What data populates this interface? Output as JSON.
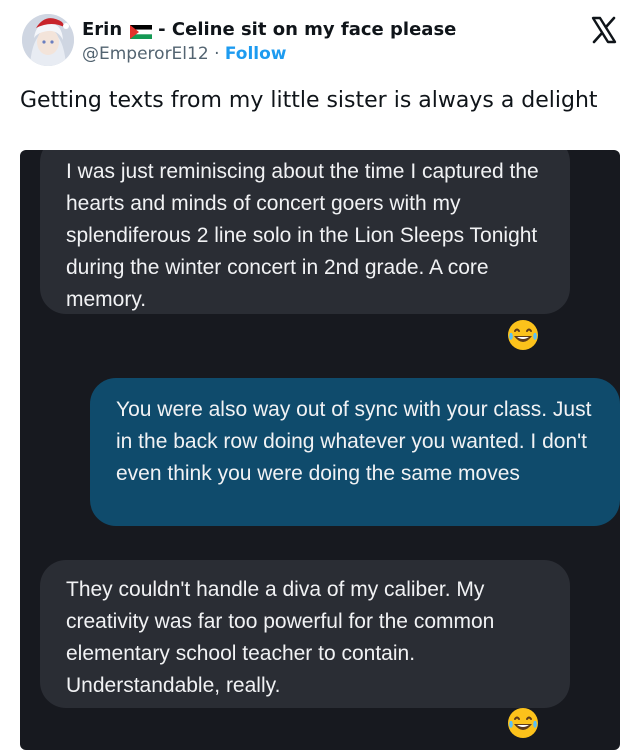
{
  "author": {
    "name": "Erin",
    "name_suffix": "- Celine sit on my face please",
    "handle": "@EmperorEl12",
    "separator": "·",
    "follow_label": "Follow"
  },
  "icons": {
    "flag": "palestine-flag-icon",
    "logo": "x-logo-icon",
    "reaction": "laughing-tears-emoji"
  },
  "tweet": {
    "text": "Getting texts from my little sister is always a delight"
  },
  "messages": [
    {
      "side": "incoming",
      "text": "I was just reminiscing about the time I captured the hearts and minds of concert goers with my splendiferous 2 line solo in the Lion Sleeps Tonight during the winter concert in 2nd grade. A core memory."
    },
    {
      "side": "outgoing",
      "text": "You were also way out of sync with your class. Just in the back row doing whatever you wanted. I don't even think you were doing the same moves"
    },
    {
      "side": "incoming",
      "text": "They couldn't handle a diva of my caliber. My creativity was far too powerful for the common elementary school teacher to contain. Understandable, really."
    }
  ],
  "colors": {
    "follow": "#1d9bf0",
    "chat_background": "#17191f",
    "incoming_bubble": "#2a2d34",
    "outgoing_bubble": "#0f4b6c"
  }
}
